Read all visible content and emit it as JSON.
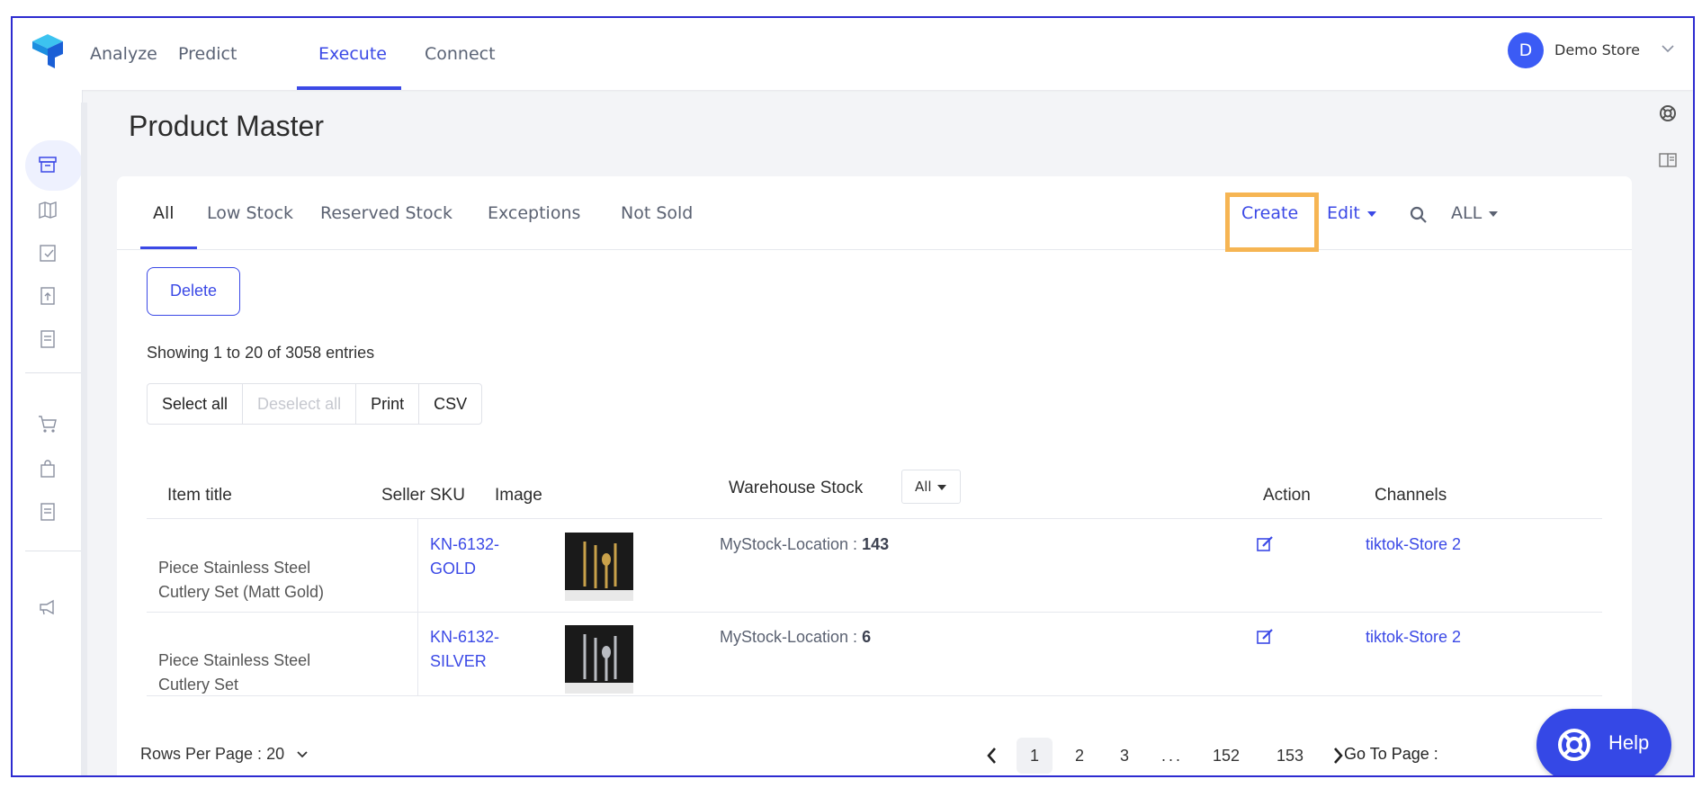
{
  "topnav": {
    "tabs": [
      {
        "label": "Analyze"
      },
      {
        "label": "Predict"
      },
      {
        "label": "Execute"
      },
      {
        "label": "Connect"
      }
    ],
    "active_tab": "Execute",
    "user": {
      "initial": "D",
      "name": "Demo Store"
    }
  },
  "page": {
    "title": "Product Master"
  },
  "subtabs": [
    {
      "label": "All"
    },
    {
      "label": "Low Stock"
    },
    {
      "label": "Reserved Stock"
    },
    {
      "label": "Exceptions"
    },
    {
      "label": "Not Sold"
    }
  ],
  "toolbar": {
    "create": "Create",
    "edit": "Edit",
    "all": "ALL",
    "delete": "Delete"
  },
  "table_info": {
    "showing": "Showing 1 to 20 of 3058 entries"
  },
  "table_buttons": {
    "select_all": "Select all",
    "deselect_all": "Deselect all",
    "print": "Print",
    "csv": "CSV"
  },
  "columns": {
    "item_title": "Item title",
    "seller_sku": "Seller SKU",
    "image": "Image",
    "warehouse_stock": "Warehouse Stock",
    "warehouse_filter": "All",
    "action": "Action",
    "channels": "Channels"
  },
  "rows": [
    {
      "title": "Piece Stainless Steel Cutlery Set (Matt Gold)",
      "sku": "KN-6132-GOLD",
      "stock_label": "MyStock-Location : ",
      "stock_value": "143",
      "channel": "tiktok-Store 2"
    },
    {
      "title": "Piece Stainless Steel Cutlery Set",
      "sku": "KN-6132-SILVER",
      "stock_label": "MyStock-Location : ",
      "stock_value": "6",
      "channel": "tiktok-Store 2"
    }
  ],
  "pagination": {
    "rows_per_page_label": "Rows Per Page :",
    "rows_per_page": "20",
    "pages": [
      "1",
      "2",
      "3",
      "...",
      "152",
      "153"
    ],
    "current": "1",
    "go_to_label": "Go To Page :"
  },
  "help": {
    "label": "Help"
  },
  "colors": {
    "accent": "#3b49e6",
    "highlight": "#f6b553",
    "help_bg": "#3548e6"
  }
}
